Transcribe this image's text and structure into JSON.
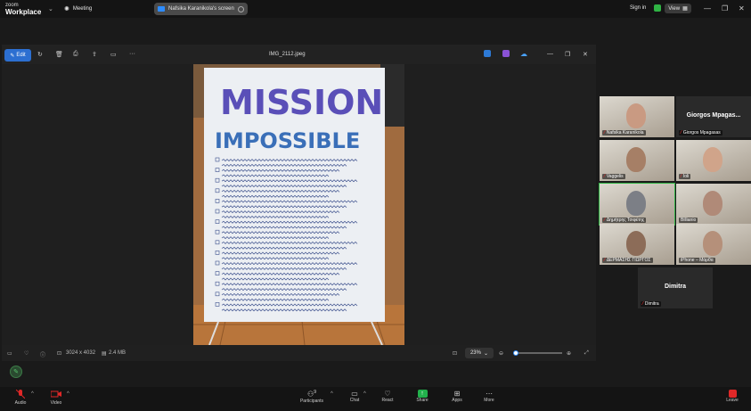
{
  "app": {
    "logo_line1": "zoom",
    "logo_line2": "Workplace",
    "meeting_label": "Meeting",
    "share_label": "Nafsika Karanikola's screen",
    "sign_in": "Sign in",
    "view": "View"
  },
  "viewer": {
    "edit_label": "Edit",
    "title": "IMG_2112.jpeg",
    "dimensions": "3024 x 4032",
    "file_size": "2.4 MB",
    "zoom": "23%"
  },
  "poster": {
    "title_line1": "MISSION",
    "title_line2": "IMPOSSIBLE"
  },
  "participants": [
    {
      "name": "Nafsika Karanikola",
      "muted": true,
      "video": true
    },
    {
      "name": "Giorgos Mpagasas",
      "muted": true,
      "video": false,
      "display_name": "Giorgos  Mpagas..."
    },
    {
      "name": "Vaggelis",
      "muted": true,
      "video": true
    },
    {
      "name": "Ioli",
      "muted": true,
      "video": true
    },
    {
      "name": "Δημήτρης Τσιφέτης",
      "muted": true,
      "video": true
    },
    {
      "name": "Billianio",
      "muted": false,
      "video": true
    },
    {
      "name": "ΔΕΡΜΑΣΗΣ ΓΙΩΡΓΟΣ",
      "muted": true,
      "video": true
    },
    {
      "name": "iPhone – Μάρθα",
      "muted": false,
      "video": true
    },
    {
      "name": "Dimitra",
      "muted": true,
      "video": false,
      "display_name": "Dimitra"
    }
  ],
  "bottom": {
    "audio": "Audio",
    "video": "Video",
    "participants": "Participants",
    "participants_count": "9",
    "chat": "Chat",
    "react": "React",
    "share": "Share",
    "apps": "Apps",
    "more": "More",
    "leave": "Leave"
  }
}
